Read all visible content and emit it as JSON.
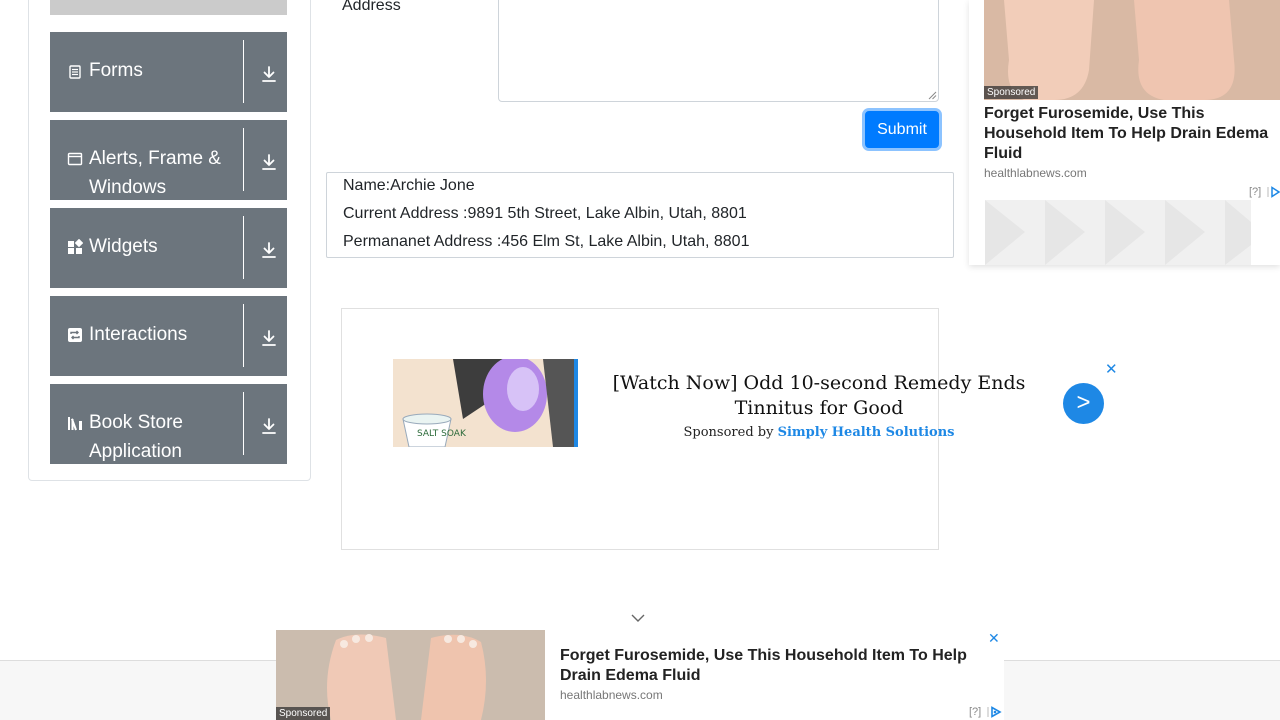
{
  "sidebar": {
    "groups": [
      {
        "label": "Forms",
        "icon": "document-icon"
      },
      {
        "label": "Alerts, Frame & Windows",
        "icon": "window-icon"
      },
      {
        "label": "Widgets",
        "icon": "widgets-icon"
      },
      {
        "label": "Interactions",
        "icon": "interactions-icon"
      },
      {
        "label": "Book Store Application",
        "icon": "books-icon"
      }
    ]
  },
  "form": {
    "permanent_address_label": "Address",
    "permanent_address_value": "",
    "submit_label": "Submit"
  },
  "output": {
    "name": "Name:Archie Jone",
    "current_address": "Current Address :9891 5th Street, Lake Albin, Utah, 8801",
    "permanent_address": "Permananet Address :456 Elm St, Lake Albin, Utah, 8801"
  },
  "ads": {
    "middle": {
      "title": "[Watch Now] Odd 10-second Remedy Ends Tinnitus for Good",
      "sponsored_prefix": "Sponsored by ",
      "sponsor": "Simply Health Solutions",
      "close": "✕",
      "go": ">",
      "image_text": "SALT SOAK",
      "accent": "#1e88e5"
    },
    "right": {
      "tag": "Sponsored",
      "title": "Forget Furosemide, Use This Household Item To Help Drain Edema Fluid",
      "source": "healthlabnews.com",
      "adchoice": "[?]"
    },
    "bottom": {
      "tag": "Sponsored",
      "title": "Forget Furosemide, Use This Household Item To Help Drain Edema Fluid",
      "source": "healthlabnews.com",
      "adchoice": "[?]",
      "close": "✕"
    }
  },
  "colors": {
    "sidebar_group_bg": "#6c757d",
    "primary_button": "#007bff"
  }
}
